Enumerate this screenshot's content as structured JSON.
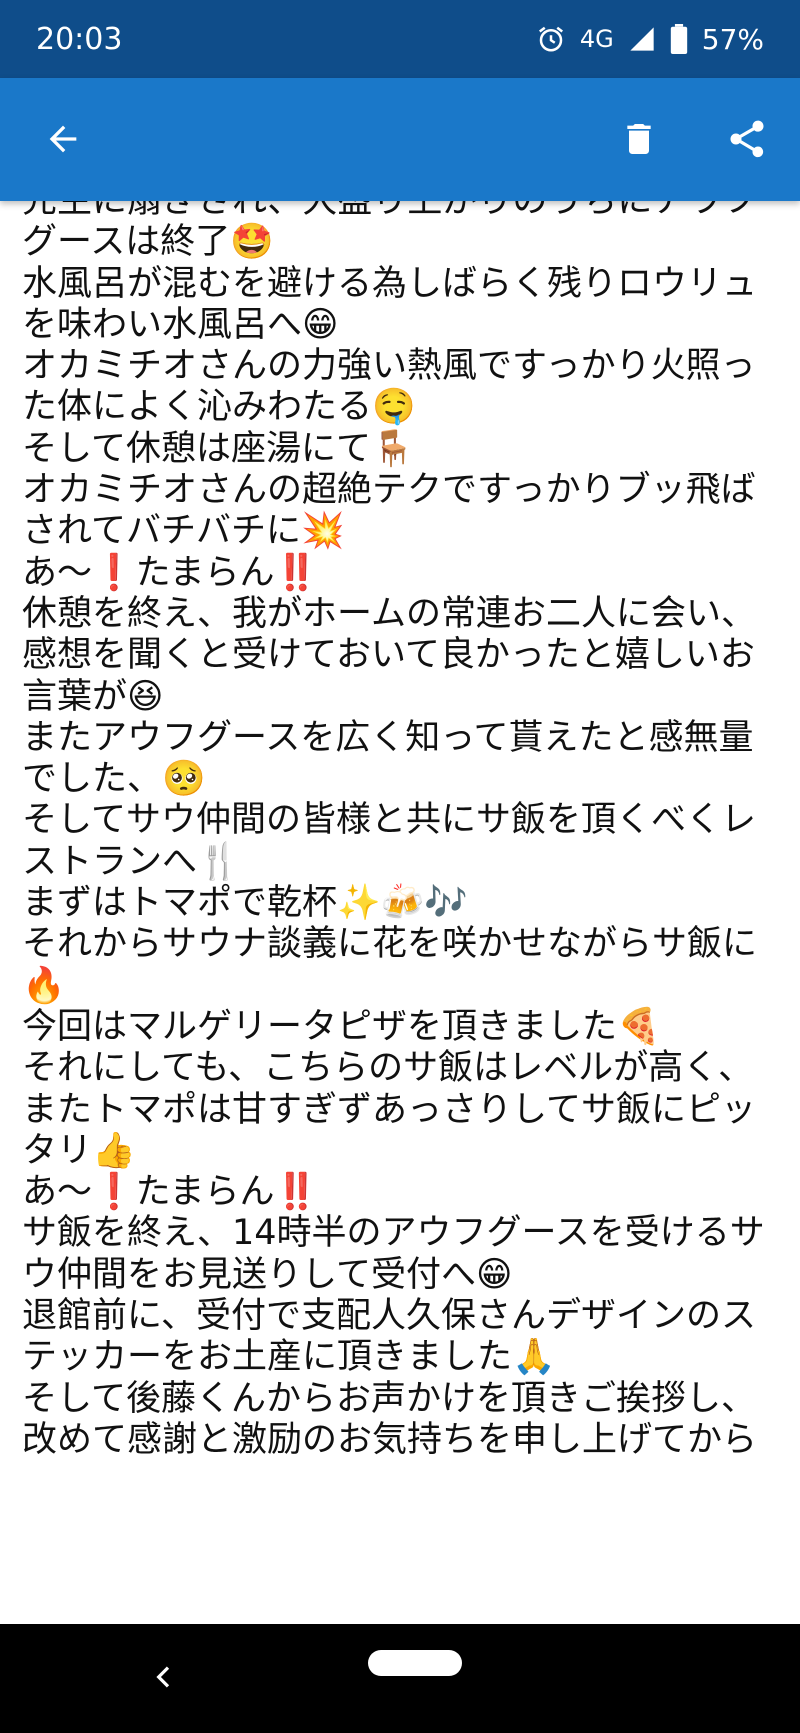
{
  "status_bar": {
    "time": "20:03",
    "network": "4G",
    "battery": "57%"
  },
  "app_bar": {
    "back_icon": "arrow-left-icon",
    "delete_icon": "trash-icon",
    "share_icon": "share-icon"
  },
  "content": {
    "lines": [
      "先生に扇ぎされ、大盛り上がりのうちにアウフ",
      "グースは終了🤩",
      "水風呂が混むを避ける為しばらく残りロウリュ",
      "を味わい水風呂へ😁",
      "オカミチオさんの力強い熱風ですっかり火照っ",
      "た体によく沁みわたる🤤",
      "そして休憩は座湯にて🪑",
      "オカミチオさんの超絶テクですっかりブッ飛ば",
      "されてバチバチに💥",
      "あ〜❗たまらん‼️",
      "休憩を終え、我がホームの常連お二人に会い、",
      "感想を聞くと受けておいて良かったと嬉しいお",
      "言葉が😆",
      "またアウフグースを広く知って貰えたと感無量",
      "でした、🥺",
      "そしてサウ仲間の皆様と共にサ飯を頂くべくレ",
      "ストランへ🍴",
      "まずはトマポで乾杯✨🍻🎶",
      "それからサウナ談義に花を咲かせながらサ飯に",
      "🔥",
      "今回はマルゲリータピザを頂きました🍕",
      "それにしても、こちらのサ飯はレベルが高く、",
      "またトマポは甘すぎずあっさりしてサ飯にピッ",
      "タリ👍",
      "あ〜❗たまらん‼️",
      "サ飯を終え、14時半のアウフグースを受けるサ",
      "ウ仲間をお見送りして受付へ😁",
      "退館前に、受付で支配人久保さんデザインのス",
      "テッカーをお土産に頂きました🙏",
      "そして後藤くんからお声かけを頂きご挨拶し、",
      "改めて感謝と激励のお気持ちを申し上げてから"
    ]
  },
  "nav_bar": {
    "back_icon": "nav-back-icon",
    "home_icon": "home-pill-icon"
  }
}
